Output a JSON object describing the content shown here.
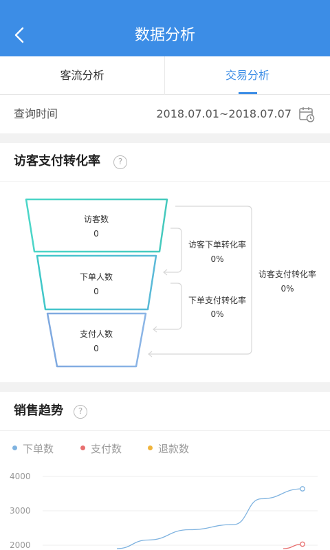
{
  "header": {
    "title": "数据分析"
  },
  "tabs": [
    {
      "label": "客流分析"
    },
    {
      "label": "交易分析"
    }
  ],
  "query": {
    "label": "查询时间",
    "range": "2018.07.01~2018.07.07"
  },
  "funnel_card": {
    "title": "访客支付转化率",
    "stages": [
      {
        "label": "访客数",
        "value": "0"
      },
      {
        "label": "下单人数",
        "value": "0"
      },
      {
        "label": "支付人数",
        "value": "0"
      }
    ],
    "rates": [
      {
        "label": "访客下单转化率",
        "value": "0%"
      },
      {
        "label": "下单支付转化率",
        "value": "0%"
      },
      {
        "label": "访客支付转化率",
        "value": "0%"
      }
    ]
  },
  "sales_card": {
    "title": "销售趋势",
    "legend": [
      {
        "label": "下单数",
        "color": "#7fb3e0"
      },
      {
        "label": "支付数",
        "color": "#e86f6f"
      },
      {
        "label": "退款数",
        "color": "#f0b43c"
      }
    ]
  },
  "chart_data": {
    "type": "line",
    "y_ticks": [
      "4000",
      "3000",
      "2000"
    ],
    "ylim": [
      2000,
      4000
    ],
    "series": [
      {
        "name": "下单数",
        "color": "#7fb3e0",
        "values": [
          1900,
          2150,
          2450,
          2600,
          3350,
          3640
        ]
      },
      {
        "name": "支付数",
        "color": "#e86f6f",
        "values": [
          1900,
          2030
        ]
      }
    ]
  }
}
